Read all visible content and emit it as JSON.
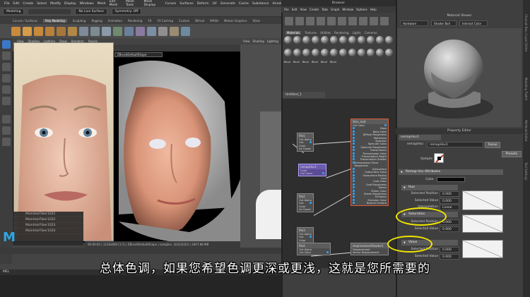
{
  "maya": {
    "menu": [
      "File",
      "Edit",
      "Create",
      "Select",
      "Modify",
      "Display",
      "Windows",
      "Mesh",
      "Edit Mesh",
      "Mesh Tools",
      "Mesh Display",
      "Curves",
      "Surfaces",
      "Deform",
      "UV",
      "Generate",
      "Cache",
      "Substance",
      "Arnold"
    ],
    "mode": "Modeling",
    "live_surface": "No Live Surface",
    "symmetry": "Symmetry: Off",
    "shelf_tabs": [
      "Curves / Surfaces",
      "Poly Modeling",
      "Sculpting",
      "Rigging",
      "Animation",
      "Rendering",
      "FX",
      "FX Caching",
      "Custom",
      "Bifrost",
      "MASH",
      "Motion Graphics",
      "XGen"
    ],
    "shelf_active": "Poly Modeling",
    "viewport_menu": [
      "View",
      "Shading",
      "Lighting",
      "Show",
      "Renderer",
      "Panels"
    ],
    "shape_field": "ZBrushDefaultShape",
    "viewport_status": "00:00:02 | 1120x840 (1:1) | ZBrushDefaultShape | samples: 3/2/2/2/2/2 | 2407.86 MB",
    "persp_menu": [
      "View",
      "Shading",
      "Lighting"
    ],
    "outliner_items": [
      "MainHairFiber1021",
      "MainHairFiber1022",
      "MainHairFiber1023",
      "MainHairFiber1024"
    ],
    "mel_label": "MEL",
    "logo": "M"
  },
  "hypershade": {
    "title": "Browser",
    "menu": [
      "File",
      "Edit",
      "View",
      "Create",
      "Tabs",
      "Graph",
      "Window",
      "Options",
      "Help"
    ],
    "tabs": [
      "Materials",
      "Textures",
      "Utilities",
      "Rendering",
      "Lights",
      "Cameras"
    ],
    "tab_active": "Materials",
    "swatch_labels": [
      "Bkud",
      "Bkud",
      "Bkud",
      "Bkud",
      "Bkud",
      "Bkud"
    ],
    "graph_tab": "Untitled_1",
    "nodes": {
      "file1": {
        "title": "file1",
        "rows": [
          "Out Alpha",
          "Out Color",
          "Uv Coord"
        ]
      },
      "remap": {
        "title": "remapHsv1",
        "rows": [
          "Color",
          "Out Color"
        ]
      },
      "file2": {
        "title": "file2",
        "rows": [
          "Out Alpha",
          "Out Color",
          "Uv Coord"
        ]
      },
      "file3": {
        "title": "file3",
        "rows": [
          "Out Alpha",
          "Out Color",
          "Uv Coord"
        ]
      },
      "file4": {
        "title": "file4",
        "rows": [
          "Out Alpha",
          "Out Color"
        ]
      },
      "skin": {
        "title": "Skin_mat",
        "rows": [
          "Out Color",
          "Base",
          "Base Color",
          "Diffuse Roughness",
          "Metalness",
          "Specular",
          "Specular Color",
          "Specular Roughness",
          "Transmission",
          "Transmission Color",
          "Transmission Depth",
          "Transmission Scatter",
          "Transmission Extra Roughness",
          "Subsurface",
          "Subsurface Color",
          "Subsurface Radius",
          "Coat",
          "Coat Color",
          "Coat Roughness",
          "Sheen",
          "Sheen Color",
          "Sheen Roughness",
          "Emission",
          "Emission Color",
          "Normal Camera"
        ]
      },
      "disp": {
        "title": "displacementShader1",
        "rows": [
          "Displacement",
          "Vector Displacement"
        ]
      }
    }
  },
  "material_viewer": {
    "title": "Material Viewer",
    "renderer": "Hardware",
    "shape": "Shader Ball",
    "material": "Interact Color"
  },
  "property_editor": {
    "title": "Property Editor",
    "tab": "remapHsv1",
    "node_label": "remapHsv:",
    "node_value": "remapHsv1",
    "focus_button": "Focus",
    "presets_button": "Presets",
    "sample_label": "Sample",
    "section_main": "Remap Hsv Attributes",
    "color_label": "Color",
    "section_hue": "Hue",
    "section_saturation": "Saturation",
    "section_value": "Value",
    "selected_position": "Selected Position",
    "selected_value": "Selected Value",
    "interpolation": "Interpolation",
    "interp_value": "Linear",
    "hue_pos": "0.000",
    "hue_val": "0.000",
    "sat_pos": "0.000",
    "sat_val": "0.000",
    "val_pos": "0.000",
    "val_val": "0.000"
  },
  "side_labels": [
    "Channel Box / Layer Editor",
    "Modeling Toolkit",
    "Attribute Editor",
    "Tool Settings"
  ],
  "subtitle": "总体色调，如果您希望色调更深或更浅，这就是您所需要的",
  "colors": {
    "highlight": "#f2e600",
    "maya_blue": "#2da6e0",
    "node_border": "#888888"
  }
}
